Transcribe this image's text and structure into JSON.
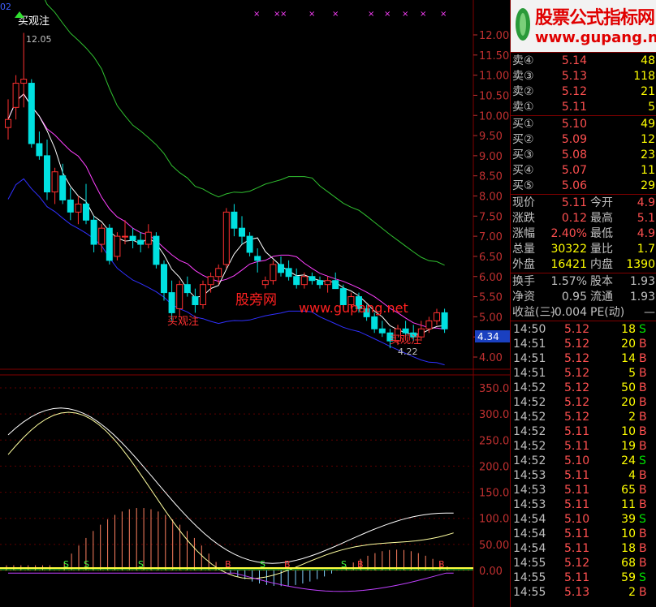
{
  "chart": {
    "top_label": "02",
    "annotation_label": "买观注",
    "high_label": "12.05",
    "low_label": "4.22",
    "current_price_tag": "4.34",
    "watermark_cn": "股旁网",
    "watermark_url": "www.gupang.net",
    "price_axis": [
      "12.00",
      "11.50",
      "11.00",
      "10.50",
      "10.00",
      "9.50",
      "9.00",
      "8.50",
      "8.00",
      "7.50",
      "7.00",
      "6.50",
      "6.00",
      "5.50",
      "5.00",
      "4.50",
      "4.00"
    ],
    "indicator_axis": [
      "350.00",
      "300.00",
      "250.00",
      "200.00",
      "150.00",
      "100.00",
      "50.00",
      "0.00"
    ],
    "signal_markers": [
      "S",
      "S",
      "S",
      "B",
      "S",
      "B",
      "S",
      "B",
      "B"
    ],
    "colors": {
      "up": "#ff3030",
      "down": "#00e0e0",
      "ma_white": "#ffffff",
      "ma_magenta": "#ff40ff",
      "band_green": "#30c030",
      "band_blue": "#3030ff",
      "grid": "#800000"
    }
  },
  "logo": {
    "title": "股票公式指标网",
    "url": "www.gupang.net"
  },
  "quote": {
    "sell": [
      {
        "label": "卖④",
        "price": "5.14",
        "vol": "48"
      },
      {
        "label": "卖③",
        "price": "5.13",
        "vol": "118"
      },
      {
        "label": "卖②",
        "price": "5.12",
        "vol": "21"
      },
      {
        "label": "卖①",
        "price": "5.11",
        "vol": "5"
      }
    ],
    "buy": [
      {
        "label": "买①",
        "price": "5.10",
        "vol": "49"
      },
      {
        "label": "买②",
        "price": "5.09",
        "vol": "12"
      },
      {
        "label": "买③",
        "price": "5.08",
        "vol": "23"
      },
      {
        "label": "买④",
        "price": "5.07",
        "vol": "11"
      },
      {
        "label": "买⑤",
        "price": "5.06",
        "vol": "29"
      }
    ],
    "stats": [
      {
        "l1": "现价",
        "v1": "5.11",
        "l2": "今开",
        "v2": "4.9"
      },
      {
        "l1": "涨跌",
        "v1": "0.12",
        "l2": "最高",
        "v2": "5.1"
      },
      {
        "l1": "涨幅",
        "v1": "2.40%",
        "l2": "最低",
        "v2": "4.9"
      },
      {
        "l1": "总量",
        "v1": "30322",
        "l2": "量比",
        "v2": "1.7"
      },
      {
        "l1": "外盘",
        "v1": "16421",
        "l2": "内盘",
        "v2": "1390"
      }
    ],
    "stats2": [
      {
        "l1": "换手",
        "v1": "1.57%",
        "l2": "股本",
        "v2": "1.93"
      },
      {
        "l1": "净资",
        "v1": "0.95",
        "l2": "流通",
        "v2": "1.93"
      },
      {
        "l1": "收益(三)",
        "v1": "-0.004",
        "l2": "PE(动)",
        "v2": "—"
      }
    ]
  },
  "ticks": [
    {
      "time": "14:50",
      "price": "5.12",
      "vol": "18",
      "side": "S"
    },
    {
      "time": "14:51",
      "price": "5.12",
      "vol": "20",
      "side": "B"
    },
    {
      "time": "14:51",
      "price": "5.12",
      "vol": "14",
      "side": "B"
    },
    {
      "time": "14:51",
      "price": "5.12",
      "vol": "5",
      "side": "B"
    },
    {
      "time": "14:52",
      "price": "5.12",
      "vol": "50",
      "side": "B"
    },
    {
      "time": "14:52",
      "price": "5.12",
      "vol": "20",
      "side": "B"
    },
    {
      "time": "14:52",
      "price": "5.12",
      "vol": "2",
      "side": "B"
    },
    {
      "time": "14:52",
      "price": "5.11",
      "vol": "10",
      "side": "B"
    },
    {
      "time": "14:52",
      "price": "5.11",
      "vol": "19",
      "side": "B"
    },
    {
      "time": "14:52",
      "price": "5.10",
      "vol": "24",
      "side": "S"
    },
    {
      "time": "14:53",
      "price": "5.11",
      "vol": "4",
      "side": "B"
    },
    {
      "time": "14:53",
      "price": "5.11",
      "vol": "65",
      "side": "B"
    },
    {
      "time": "14:53",
      "price": "5.11",
      "vol": "11",
      "side": "B"
    },
    {
      "time": "14:54",
      "price": "5.10",
      "vol": "39",
      "side": "S"
    },
    {
      "time": "14:54",
      "price": "5.11",
      "vol": "10",
      "side": "B"
    },
    {
      "time": "14:54",
      "price": "5.11",
      "vol": "18",
      "side": "B"
    },
    {
      "time": "14:55",
      "price": "5.12",
      "vol": "68",
      "side": "B"
    },
    {
      "time": "14:55",
      "price": "5.11",
      "vol": "59",
      "side": "S"
    },
    {
      "time": "14:55",
      "price": "5.13",
      "vol": "2",
      "side": "B"
    }
  ]
}
